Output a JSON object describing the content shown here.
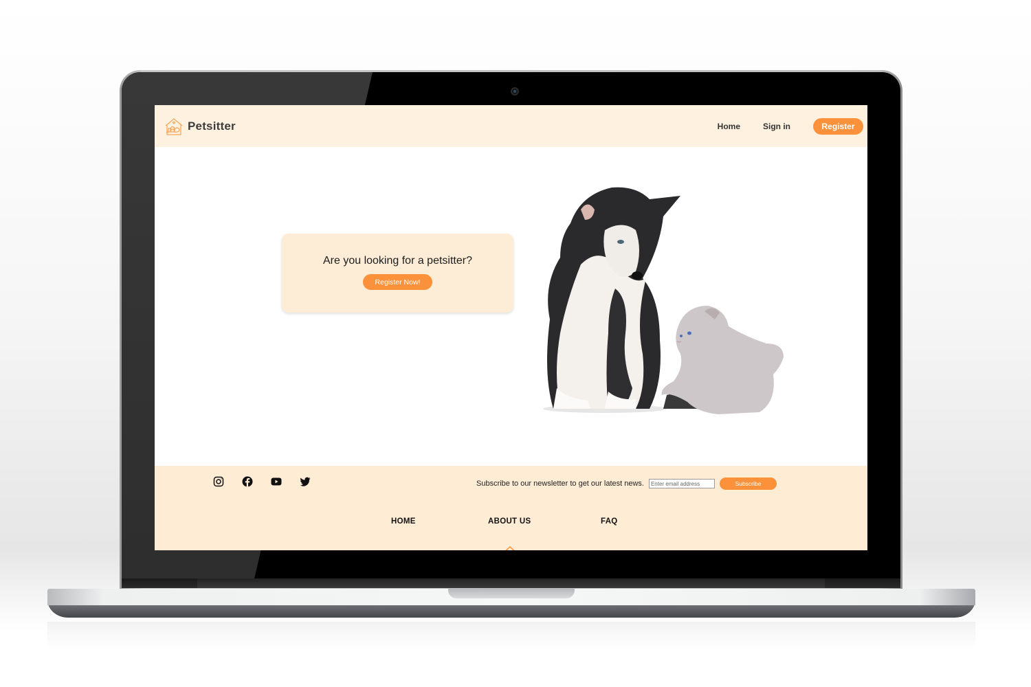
{
  "site": {
    "brand": "Petsitter",
    "brand_icon": "house-pets-icon",
    "accent_color": "#fb913a",
    "header_bg": "#fef1e0",
    "footer_bg": "#feecd5"
  },
  "header": {
    "nav": [
      {
        "label": "Home"
      },
      {
        "label": "Sign in"
      }
    ],
    "register_label": "Register"
  },
  "hero": {
    "title": "Are you looking for a petsitter?",
    "cta_label": "Register Now!",
    "image_alt": "Husky puppy looking at a grey kitten"
  },
  "footer": {
    "socials": [
      {
        "name": "instagram",
        "icon": "instagram-icon"
      },
      {
        "name": "facebook",
        "icon": "facebook-icon"
      },
      {
        "name": "youtube",
        "icon": "youtube-icon"
      },
      {
        "name": "twitter",
        "icon": "twitter-icon"
      }
    ],
    "newsletter_text": "Subscribe to our newsletter to get our latest news.",
    "email_placeholder": "Enter email address",
    "email_value": "",
    "subscribe_label": "Subscribe",
    "links": [
      {
        "label": "HOME"
      },
      {
        "label": "ABOUT US"
      },
      {
        "label": "FAQ"
      }
    ],
    "scroll_top_icon": "chevron-up-icon"
  }
}
